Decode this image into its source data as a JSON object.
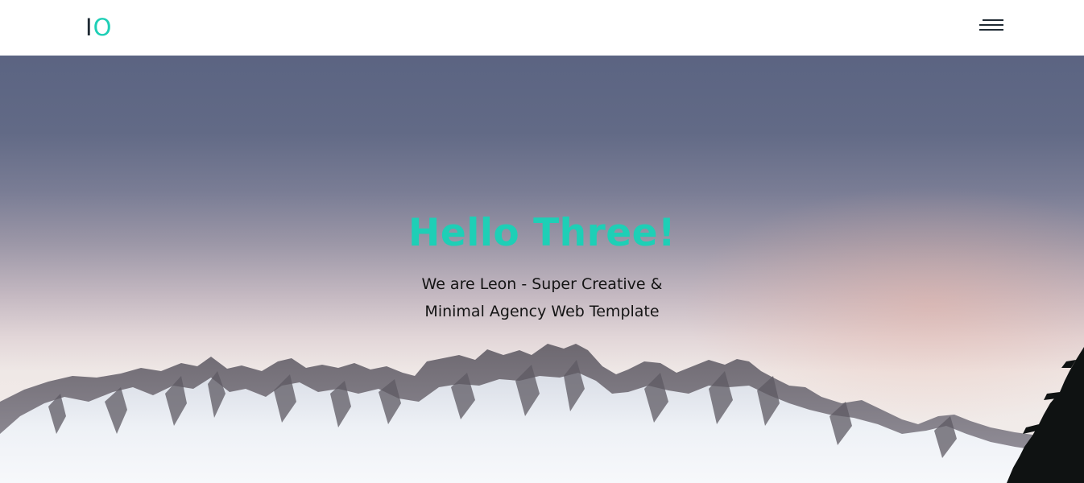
{
  "header": {
    "logo": {
      "part1": "I",
      "part2": "O"
    },
    "menu_icon": "hamburger-menu-icon"
  },
  "hero": {
    "title": "Hello Three!",
    "subtitle_line1": "We are Leon - Super Creative &",
    "subtitle_line2": "Minimal Agency Web Template",
    "background_image": "snowy-mountain-range"
  },
  "colors": {
    "accent": "#1ecfb6",
    "logo_dark": "#1f2a33",
    "sky_top": "#5b6482",
    "text_dark": "#141414"
  }
}
